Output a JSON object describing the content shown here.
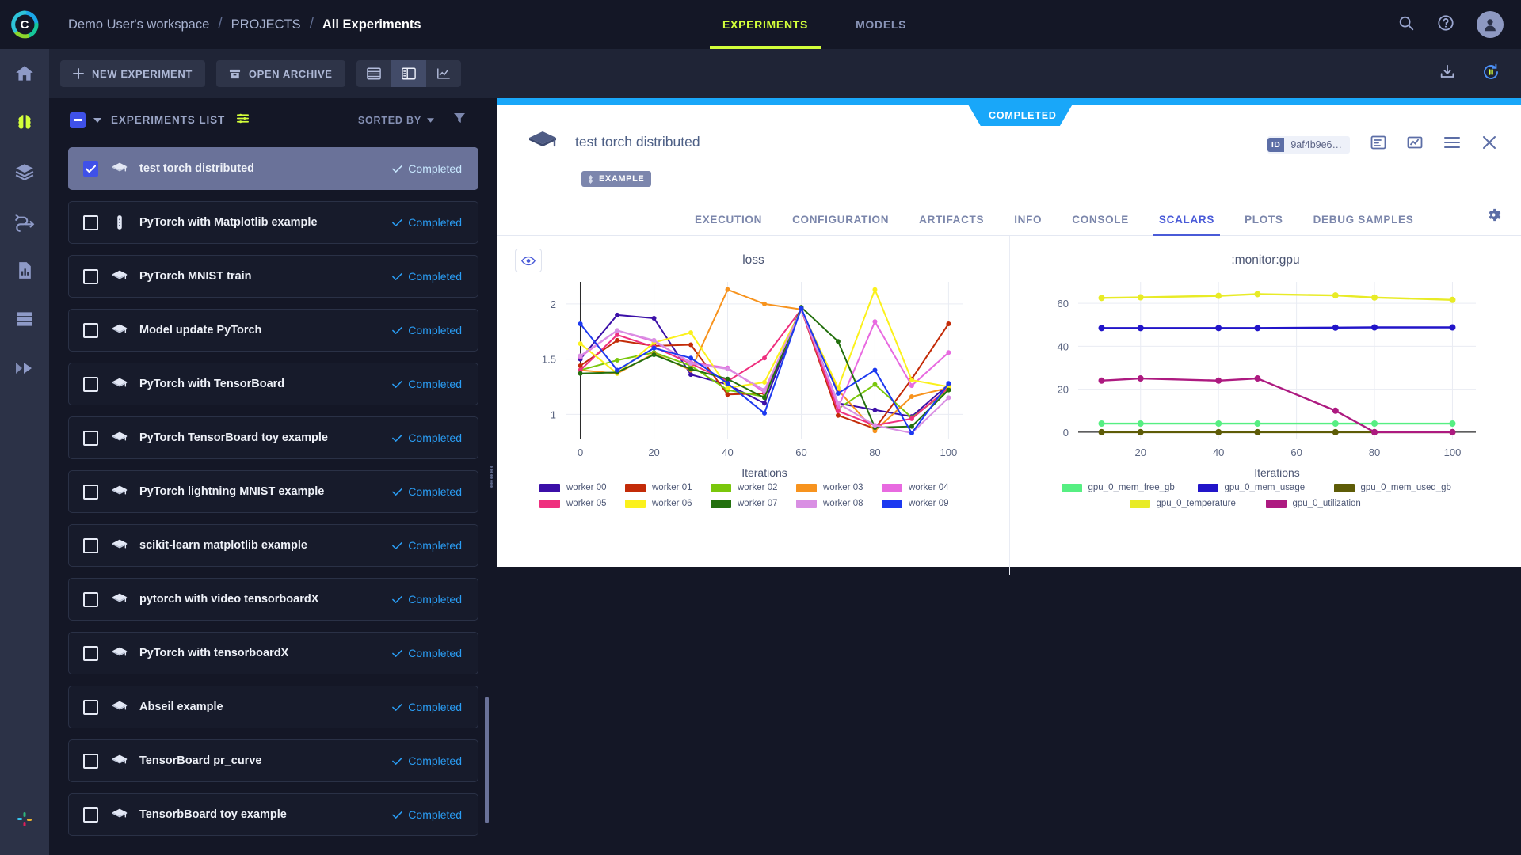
{
  "app": {
    "logo_icon": "clearml-logo-icon"
  },
  "header": {
    "breadcrumb": [
      "Demo User's workspace",
      "PROJECTS",
      "All Experiments"
    ],
    "separator": "/",
    "nav_tabs": [
      {
        "label": "EXPERIMENTS",
        "active": true
      },
      {
        "label": "MODELS",
        "active": false
      }
    ],
    "icons": [
      "search-icon",
      "help-icon",
      "user-avatar-icon"
    ]
  },
  "rail": {
    "items": [
      {
        "name": "home-icon",
        "active": false
      },
      {
        "name": "brain-icon",
        "active": true
      },
      {
        "name": "datasets-layers-icon",
        "active": false
      },
      {
        "name": "pipelines-icon",
        "active": false
      },
      {
        "name": "reports-icon",
        "active": false
      },
      {
        "name": "resources-server-icon",
        "active": false
      },
      {
        "name": "fast-forward-icon",
        "active": false
      }
    ],
    "bottom": {
      "name": "slack-icon"
    }
  },
  "toolbar": {
    "new_experiment_label": "NEW EXPERIMENT",
    "open_archive_label": "OPEN ARCHIVE",
    "view_modes": [
      {
        "name": "table-view-icon",
        "active": false
      },
      {
        "name": "split-view-icon",
        "active": true
      },
      {
        "name": "compare-chart-view-icon",
        "active": false
      }
    ],
    "right_icons": [
      "download-icon",
      "auto-refresh-paused-icon"
    ]
  },
  "list_panel": {
    "title": "EXPERIMENTS LIST",
    "filter_toggle_icon": "filter-sliders-icon",
    "sorted_by_label": "SORTED BY",
    "filter_icon": "funnel-filter-icon",
    "select_all_state": "indeterminate",
    "status_label": "Completed",
    "items": [
      {
        "name": "test torch distributed",
        "icon": "graduation-cap-icon",
        "status": "Completed",
        "checked": true,
        "selected": true
      },
      {
        "name": "PyTorch with Matplotlib example",
        "icon": "test-tube-icon",
        "status": "Completed",
        "checked": false,
        "selected": false
      },
      {
        "name": "PyTorch MNIST train",
        "icon": "graduation-cap-icon",
        "status": "Completed",
        "checked": false,
        "selected": false
      },
      {
        "name": "Model update PyTorch",
        "icon": "graduation-cap-icon",
        "status": "Completed",
        "checked": false,
        "selected": false
      },
      {
        "name": "PyTorch with TensorBoard",
        "icon": "graduation-cap-icon",
        "status": "Completed",
        "checked": false,
        "selected": false
      },
      {
        "name": "PyTorch TensorBoard toy example",
        "icon": "graduation-cap-icon",
        "status": "Completed",
        "checked": false,
        "selected": false
      },
      {
        "name": "PyTorch lightning MNIST example",
        "icon": "graduation-cap-icon",
        "status": "Completed",
        "checked": false,
        "selected": false
      },
      {
        "name": "scikit-learn matplotlib example",
        "icon": "graduation-cap-icon",
        "status": "Completed",
        "checked": false,
        "selected": false
      },
      {
        "name": "pytorch with video tensorboardX",
        "icon": "graduation-cap-icon",
        "status": "Completed",
        "checked": false,
        "selected": false
      },
      {
        "name": "PyTorch with tensorboardX",
        "icon": "graduation-cap-icon",
        "status": "Completed",
        "checked": false,
        "selected": false
      },
      {
        "name": "Abseil example",
        "icon": "graduation-cap-icon",
        "status": "Completed",
        "checked": false,
        "selected": false
      },
      {
        "name": "TensorBoard pr_curve",
        "icon": "graduation-cap-icon",
        "status": "Completed",
        "checked": false,
        "selected": false
      },
      {
        "name": "TensorbBoard toy example",
        "icon": "graduation-cap-icon",
        "status": "Completed",
        "checked": false,
        "selected": false
      }
    ]
  },
  "detail": {
    "status_flag": "COMPLETED",
    "title": "test torch distributed",
    "tag": "EXAMPLE",
    "id_badge_label": "ID",
    "id_value": "9af4b9e6…",
    "head_icons": [
      "details-panel-icon",
      "plots-panel-icon",
      "menu-icon",
      "close-icon"
    ],
    "settings_icon": "gear-icon",
    "tabs": [
      {
        "label": "EXECUTION",
        "active": false
      },
      {
        "label": "CONFIGURATION",
        "active": false
      },
      {
        "label": "ARTIFACTS",
        "active": false
      },
      {
        "label": "INFO",
        "active": false
      },
      {
        "label": "CONSOLE",
        "active": false
      },
      {
        "label": "SCALARS",
        "active": true
      },
      {
        "label": "PLOTS",
        "active": false
      },
      {
        "label": "DEBUG SAMPLES",
        "active": false
      }
    ],
    "eye_icon": "toggle-visibility-eye-icon"
  },
  "chart_data": [
    {
      "type": "line",
      "title": "loss",
      "xlabel": "Iterations",
      "ylabel": "",
      "xlim": [
        -4,
        104
      ],
      "ylim": [
        0.78,
        2.2
      ],
      "xticks": [
        0,
        20,
        40,
        60,
        80,
        100
      ],
      "yticks": [
        1,
        1.5,
        2
      ],
      "grid": true,
      "legend_position": "bottom",
      "x": [
        0,
        10,
        20,
        30,
        40,
        50,
        60,
        70,
        80,
        90,
        100
      ],
      "series": [
        {
          "name": "worker 00",
          "color": "#3b0fa8",
          "values": [
            1.5,
            1.9,
            1.87,
            1.36,
            1.27,
            1.1,
            1.96,
            1.1,
            1.04,
            0.98,
            1.27
          ]
        },
        {
          "name": "worker 01",
          "color": "#c32b08",
          "values": [
            1.44,
            1.67,
            1.62,
            1.63,
            1.18,
            1.19,
            1.95,
            0.99,
            0.87,
            1.32,
            1.82
          ]
        },
        {
          "name": "worker 02",
          "color": "#7ac70c",
          "values": [
            1.4,
            1.49,
            1.56,
            1.44,
            1.22,
            1.16,
            1.95,
            1.05,
            1.27,
            0.97,
            1.22
          ]
        },
        {
          "name": "worker 03",
          "color": "#f7931e",
          "values": [
            1.4,
            1.37,
            1.55,
            1.4,
            2.13,
            2.0,
            1.95,
            1.22,
            0.85,
            1.16,
            1.24
          ]
        },
        {
          "name": "worker 04",
          "color": "#e86ae0",
          "values": [
            1.52,
            1.76,
            1.66,
            1.47,
            1.42,
            1.2,
            1.95,
            1.06,
            1.84,
            1.26,
            1.56
          ]
        },
        {
          "name": "worker 05",
          "color": "#ef2f7e",
          "values": [
            1.4,
            1.72,
            1.61,
            1.46,
            1.3,
            1.51,
            1.95,
            1.03,
            0.9,
            0.96,
            1.24
          ]
        },
        {
          "name": "worker 06",
          "color": "#fbf11c",
          "values": [
            1.64,
            1.37,
            1.65,
            1.74,
            1.24,
            1.29,
            1.95,
            1.24,
            2.13,
            1.31,
            1.25
          ]
        },
        {
          "name": "worker 07",
          "color": "#23700e",
          "values": [
            1.37,
            1.38,
            1.54,
            1.41,
            1.32,
            1.15,
            1.97,
            1.66,
            0.88,
            0.89,
            1.22
          ]
        },
        {
          "name": "worker 08",
          "color": "#d98fe3",
          "values": [
            1.53,
            1.76,
            1.67,
            1.46,
            1.41,
            1.22,
            1.95,
            1.1,
            0.9,
            0.83,
            1.15
          ]
        },
        {
          "name": "worker 09",
          "color": "#1c39f0",
          "values": [
            1.82,
            1.4,
            1.6,
            1.51,
            1.28,
            1.01,
            1.96,
            1.19,
            1.4,
            0.83,
            1.28
          ]
        }
      ]
    },
    {
      "type": "line",
      "title": ":monitor:gpu",
      "xlabel": "Iterations",
      "ylabel": "",
      "xlim": [
        4,
        106
      ],
      "ylim": [
        -3,
        70
      ],
      "xticks": [
        20,
        40,
        60,
        80,
        100
      ],
      "yticks": [
        0,
        20,
        40,
        60
      ],
      "grid": true,
      "legend_position": "bottom",
      "x": [
        10,
        20,
        40,
        50,
        70,
        80,
        100
      ],
      "series": [
        {
          "name": "gpu_0_mem_free_gb",
          "color": "#56ef82",
          "values": [
            4,
            4,
            4,
            4,
            4,
            4,
            4
          ]
        },
        {
          "name": "gpu_0_mem_usage",
          "color": "#2215c9",
          "values": [
            48.5,
            48.5,
            48.5,
            48.5,
            48.7,
            48.8,
            48.8
          ]
        },
        {
          "name": "gpu_0_mem_used_gb",
          "color": "#5e5c07",
          "values": [
            0,
            0,
            0,
            0,
            0,
            0,
            0
          ]
        },
        {
          "name": "gpu_0_temperature",
          "color": "#e8eb26",
          "values": [
            62.5,
            62.8,
            63.5,
            64.3,
            63.7,
            62.7,
            61.6
          ]
        },
        {
          "name": "gpu_0_utilization",
          "color": "#ad1a80",
          "values": [
            24,
            25,
            24,
            25,
            10,
            0,
            0
          ]
        }
      ]
    }
  ]
}
